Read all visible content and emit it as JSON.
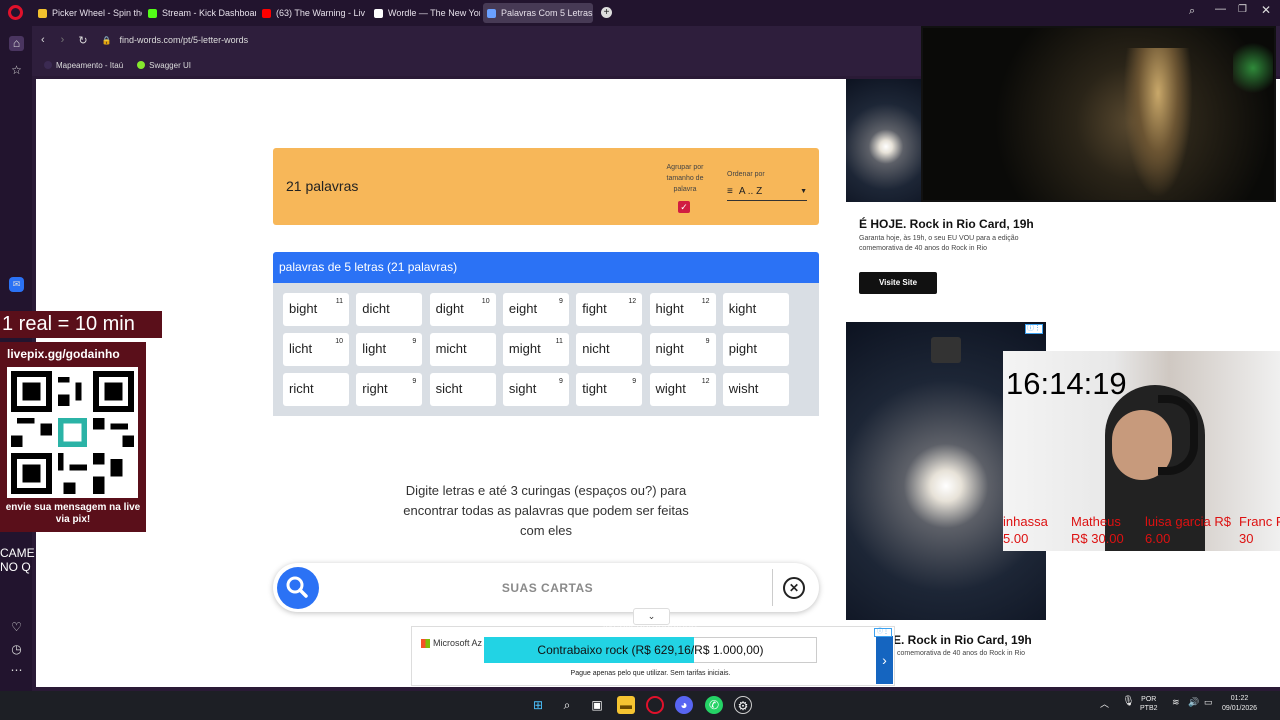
{
  "browser": {
    "tabs": [
      {
        "label": "Picker Wheel - Spin the W",
        "color": "#f2c12e"
      },
      {
        "label": "Stream - Kick Dashboard",
        "color": "#53fc18"
      },
      {
        "label": "(63) The Warning - Liv",
        "color": "#ff0000"
      },
      {
        "label": "Wordle — The New York",
        "color": "#ffffff"
      },
      {
        "label": "Palavras Com 5 Letras Em",
        "color": "#6aa0ff"
      }
    ],
    "url": "find-words.com/pt/5-letter-words",
    "bookmarks": [
      "Mapeamento - Itaú",
      "Swagger UI"
    ]
  },
  "results": {
    "count_label": "21 palavras",
    "group_label": "Agrupar por tamanho de palavra",
    "order_label": "Ordenar por",
    "order_value": "A .. Z",
    "section_title": "palavras de 5 letras (21 palavras)",
    "words": [
      {
        "w": "bight",
        "n": "11"
      },
      {
        "w": "dicht",
        "n": ""
      },
      {
        "w": "dight",
        "n": "10"
      },
      {
        "w": "eight",
        "n": "9"
      },
      {
        "w": "fight",
        "n": "12"
      },
      {
        "w": "hight",
        "n": "12"
      },
      {
        "w": "kight",
        "n": ""
      },
      {
        "w": "licht",
        "n": "10"
      },
      {
        "w": "light",
        "n": "9"
      },
      {
        "w": "micht",
        "n": ""
      },
      {
        "w": "might",
        "n": "11"
      },
      {
        "w": "nicht",
        "n": ""
      },
      {
        "w": "night",
        "n": "9"
      },
      {
        "w": "pight",
        "n": ""
      },
      {
        "w": "richt",
        "n": ""
      },
      {
        "w": "right",
        "n": "9"
      },
      {
        "w": "sicht",
        "n": ""
      },
      {
        "w": "sight",
        "n": "9"
      },
      {
        "w": "tight",
        "n": "9"
      },
      {
        "w": "wight",
        "n": "12"
      },
      {
        "w": "wisht",
        "n": ""
      }
    ]
  },
  "hint": "Digite letras e até 3 curingas (espaços ou?) para encontrar todas as palavras que podem ser feitas com eles",
  "search": {
    "placeholder": "SUAS CARTAS"
  },
  "ad": {
    "title": "É HOJE. Rock in Rio Card, 19h",
    "desc": "Garanta hoje, às 19h, o seu EU VOU para a edição comemorativa de 40 anos do Rock in Rio",
    "button": "Visite Site",
    "title2": "E. Rock in Rio Card, 19h",
    "desc2": "comemorativa de 40 anos do Rock in Rio"
  },
  "stream": {
    "clock": "16:14:19",
    "donors": [
      "inhassa 5.00",
      "Matheus R$ 30.00",
      "luisa garcia R$ 6.00",
      "Franc R$ 30"
    ],
    "real_label": "1 real = 10 min",
    "livepix_url": "livepix.gg/godainho",
    "qr_message": "envie sua mensagem na live via pix!",
    "cam_text_1": "CAME",
    "cam_text_2": "NO Q",
    "goal_text": "Contrabaixo rock (R$ 629,16/R$ 1.000,00)",
    "goal_sub": "Pague apenas pelo que utilizar. Sem tarifas iniciais.",
    "goal_progress": 0.63,
    "overlay_name": "livepix.gg/godainho",
    "ms_label": "Microsoft Az"
  },
  "taskbar": {
    "lang1": "POR",
    "lang2": "PTB2",
    "time": "01:22",
    "date": "09/01/2026"
  }
}
